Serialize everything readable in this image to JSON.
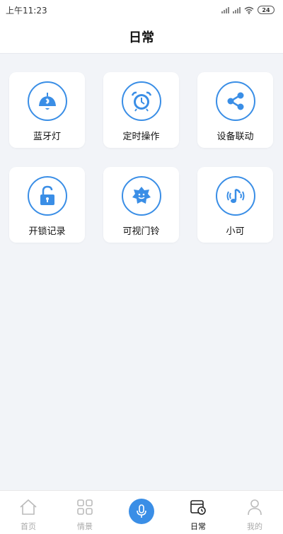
{
  "status_bar": {
    "time": "上午11:23",
    "battery": "24"
  },
  "header": {
    "title": "日常"
  },
  "colors": {
    "accent": "#3a8ee6",
    "background": "#f2f4f8"
  },
  "cards": [
    {
      "label": "蓝牙灯",
      "icon": "bluetooth-lamp-icon"
    },
    {
      "label": "定时操作",
      "icon": "alarm-clock-icon"
    },
    {
      "label": "设备联动",
      "icon": "share-icon"
    },
    {
      "label": "开锁记录",
      "icon": "unlock-icon"
    },
    {
      "label": "可视门铃",
      "icon": "doorbell-icon"
    },
    {
      "label": "小可",
      "icon": "voice-assistant-icon"
    }
  ],
  "bottom_nav": {
    "items": [
      {
        "label": "首页",
        "icon": "home-icon",
        "active": false
      },
      {
        "label": "情景",
        "icon": "scene-grid-icon",
        "active": false
      },
      {
        "label": "",
        "icon": "microphone-icon",
        "active": false
      },
      {
        "label": "日常",
        "icon": "daily-calendar-icon",
        "active": true
      },
      {
        "label": "我的",
        "icon": "user-icon",
        "active": false
      }
    ]
  }
}
